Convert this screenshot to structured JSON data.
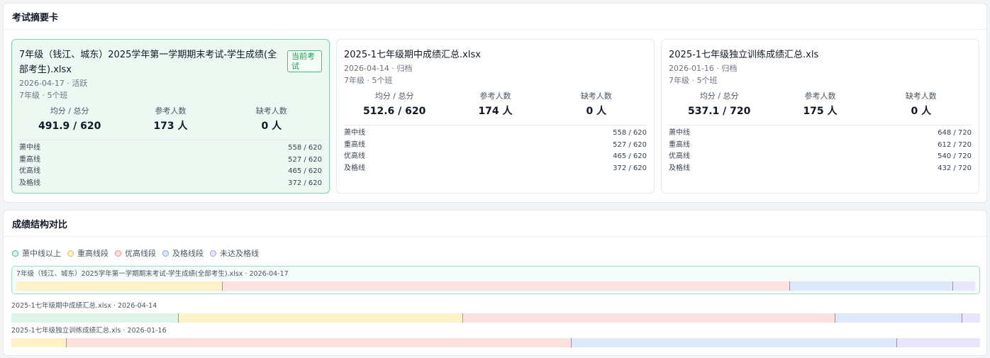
{
  "summary": {
    "title": "考试摘要卡",
    "cards": [
      {
        "title": "7年级（钱江、城东）2025学年第一学期期末考试-学生成绩(全部考生).xlsx",
        "badge": "当前考试",
        "meta1": "2026-04-17 · 活跃",
        "meta2": "7年级 · 5个班",
        "avg_label": "均分 / 总分",
        "avg_value": "491.9 / 620",
        "count_label": "参考人数",
        "count_value": "173 人",
        "absent_label": "缺考人数",
        "absent_value": "0 人",
        "lines": [
          {
            "name": "萧中线",
            "value": "558 / 620"
          },
          {
            "name": "重高线",
            "value": "527 / 620"
          },
          {
            "name": "优高线",
            "value": "465 / 620"
          },
          {
            "name": "及格线",
            "value": "372 / 620"
          }
        ]
      },
      {
        "title": "2025-1七年级期中成绩汇总.xlsx",
        "meta1": "2026-04-14 · 归档",
        "meta2": "7年级 · 5个班",
        "avg_label": "均分 / 总分",
        "avg_value": "512.6 / 620",
        "count_label": "参考人数",
        "count_value": "174 人",
        "absent_label": "缺考人数",
        "absent_value": "0 人",
        "lines": [
          {
            "name": "萧中线",
            "value": "558 / 620"
          },
          {
            "name": "重高线",
            "value": "527 / 620"
          },
          {
            "name": "优高线",
            "value": "465 / 620"
          },
          {
            "name": "及格线",
            "value": "372 / 620"
          }
        ]
      },
      {
        "title": "2025-1七年级独立训练成绩汇总.xls",
        "meta1": "2026-01-16 · 归档",
        "meta2": "7年级 · 5个班",
        "avg_label": "均分 / 总分",
        "avg_value": "537.1 / 720",
        "count_label": "参考人数",
        "count_value": "175 人",
        "absent_label": "缺考人数",
        "absent_value": "0 人",
        "lines": [
          {
            "name": "萧中线",
            "value": "648 / 720"
          },
          {
            "name": "重高线",
            "value": "612 / 720"
          },
          {
            "name": "优高线",
            "value": "540 / 720"
          },
          {
            "name": "及格线",
            "value": "432 / 720"
          }
        ]
      }
    ]
  },
  "comparison": {
    "title": "成绩结构对比",
    "legend": [
      {
        "label": "萧中线以上",
        "fill": "#dcf5e7",
        "border": "#34c38f"
      },
      {
        "label": "重高线段",
        "fill": "#fdf1c7",
        "border": "#f2b84b"
      },
      {
        "label": "优高线段",
        "fill": "#fde0e0",
        "border": "#ef8b8b"
      },
      {
        "label": "及格线段",
        "fill": "#dde9fb",
        "border": "#7aa7ea"
      },
      {
        "label": "未达及格线",
        "fill": "#e9e6fb",
        "border": "#a89be8"
      }
    ],
    "rows": [
      {
        "label": "7年级（钱江、城东）2025学年第一学期期末考试-学生成绩(全部考生).xlsx · 2026-04-17",
        "shares": [
          0,
          21.5,
          59.2,
          17.0,
          2.3
        ]
      },
      {
        "label": "2025-1七年级期中成绩汇总.xlsx · 2026-04-14",
        "shares": [
          17.3,
          29.3,
          38.5,
          13.1,
          1.8
        ]
      },
      {
        "label": "2025-1七年级独立训练成绩汇总.xls · 2026-01-16",
        "shares": [
          0,
          5.7,
          52.1,
          33.6,
          8.6
        ]
      }
    ]
  }
}
